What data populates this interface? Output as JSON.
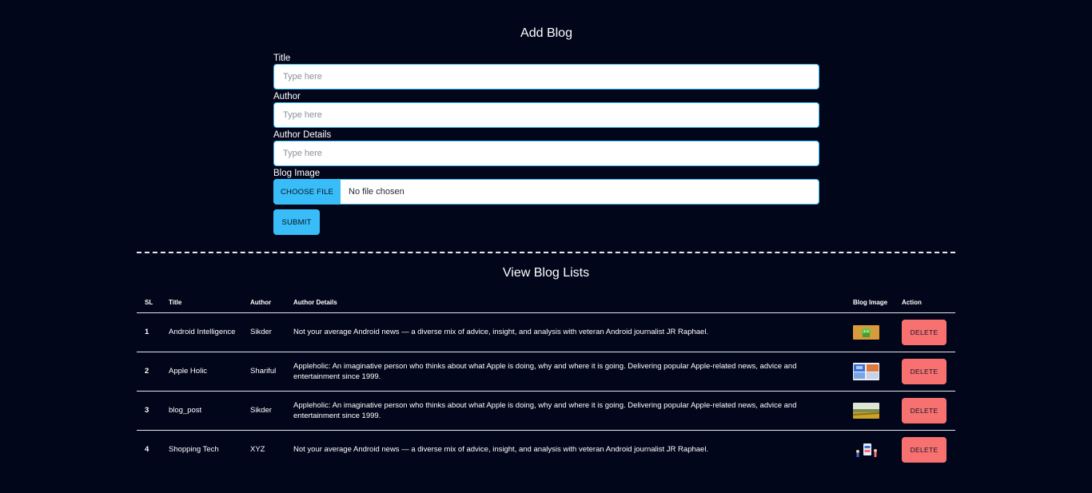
{
  "form": {
    "heading": "Add Blog",
    "title_label": "Title",
    "title_placeholder": "Type here",
    "author_label": "Author",
    "author_placeholder": "Type here",
    "author_details_label": "Author Details",
    "author_details_placeholder": "Type here",
    "image_label": "Blog Image",
    "choose_file_label": "CHOOSE FILE",
    "file_status": "No file chosen",
    "submit_label": "SUBMIT"
  },
  "list": {
    "heading": "View Blog Lists",
    "columns": {
      "sl": "SL",
      "title": "Title",
      "author": "Author",
      "author_details": "Author Details",
      "blog_image": "Blog Image",
      "action": "Action"
    },
    "delete_label": "DELETE",
    "rows": [
      {
        "sl": "1",
        "title": "Android Intelligence",
        "author": "Sikder",
        "details": "Not your average Android news — a diverse mix of advice, insight, and analysis with veteran Android journalist JR Raphael.",
        "image": "android-thumbnail"
      },
      {
        "sl": "2",
        "title": "Apple Holic",
        "author": "Shariful",
        "details": "Appleholic: An imaginative person who thinks about what Apple is doing, why and where it is going. Delivering popular Apple-related news, advice and entertainment since 1999.",
        "image": "apple-screens-thumbnail"
      },
      {
        "sl": "3",
        "title": "blog_post",
        "author": "Sikder",
        "details": "Appleholic: An imaginative person who thinks about what Apple is doing, why and where it is going. Delivering popular Apple-related news, advice and entertainment since 1999.",
        "image": "field-landscape-thumbnail"
      },
      {
        "sl": "4",
        "title": "Shopping Tech",
        "author": "XYZ",
        "details": "Not your average Android news — a diverse mix of advice, insight, and analysis with veteran Android journalist JR Raphael.",
        "image": "shopping-illustration-thumbnail"
      }
    ]
  },
  "colors": {
    "background": "#02061a",
    "accent": "#38bdf8",
    "danger": "#f87171"
  }
}
